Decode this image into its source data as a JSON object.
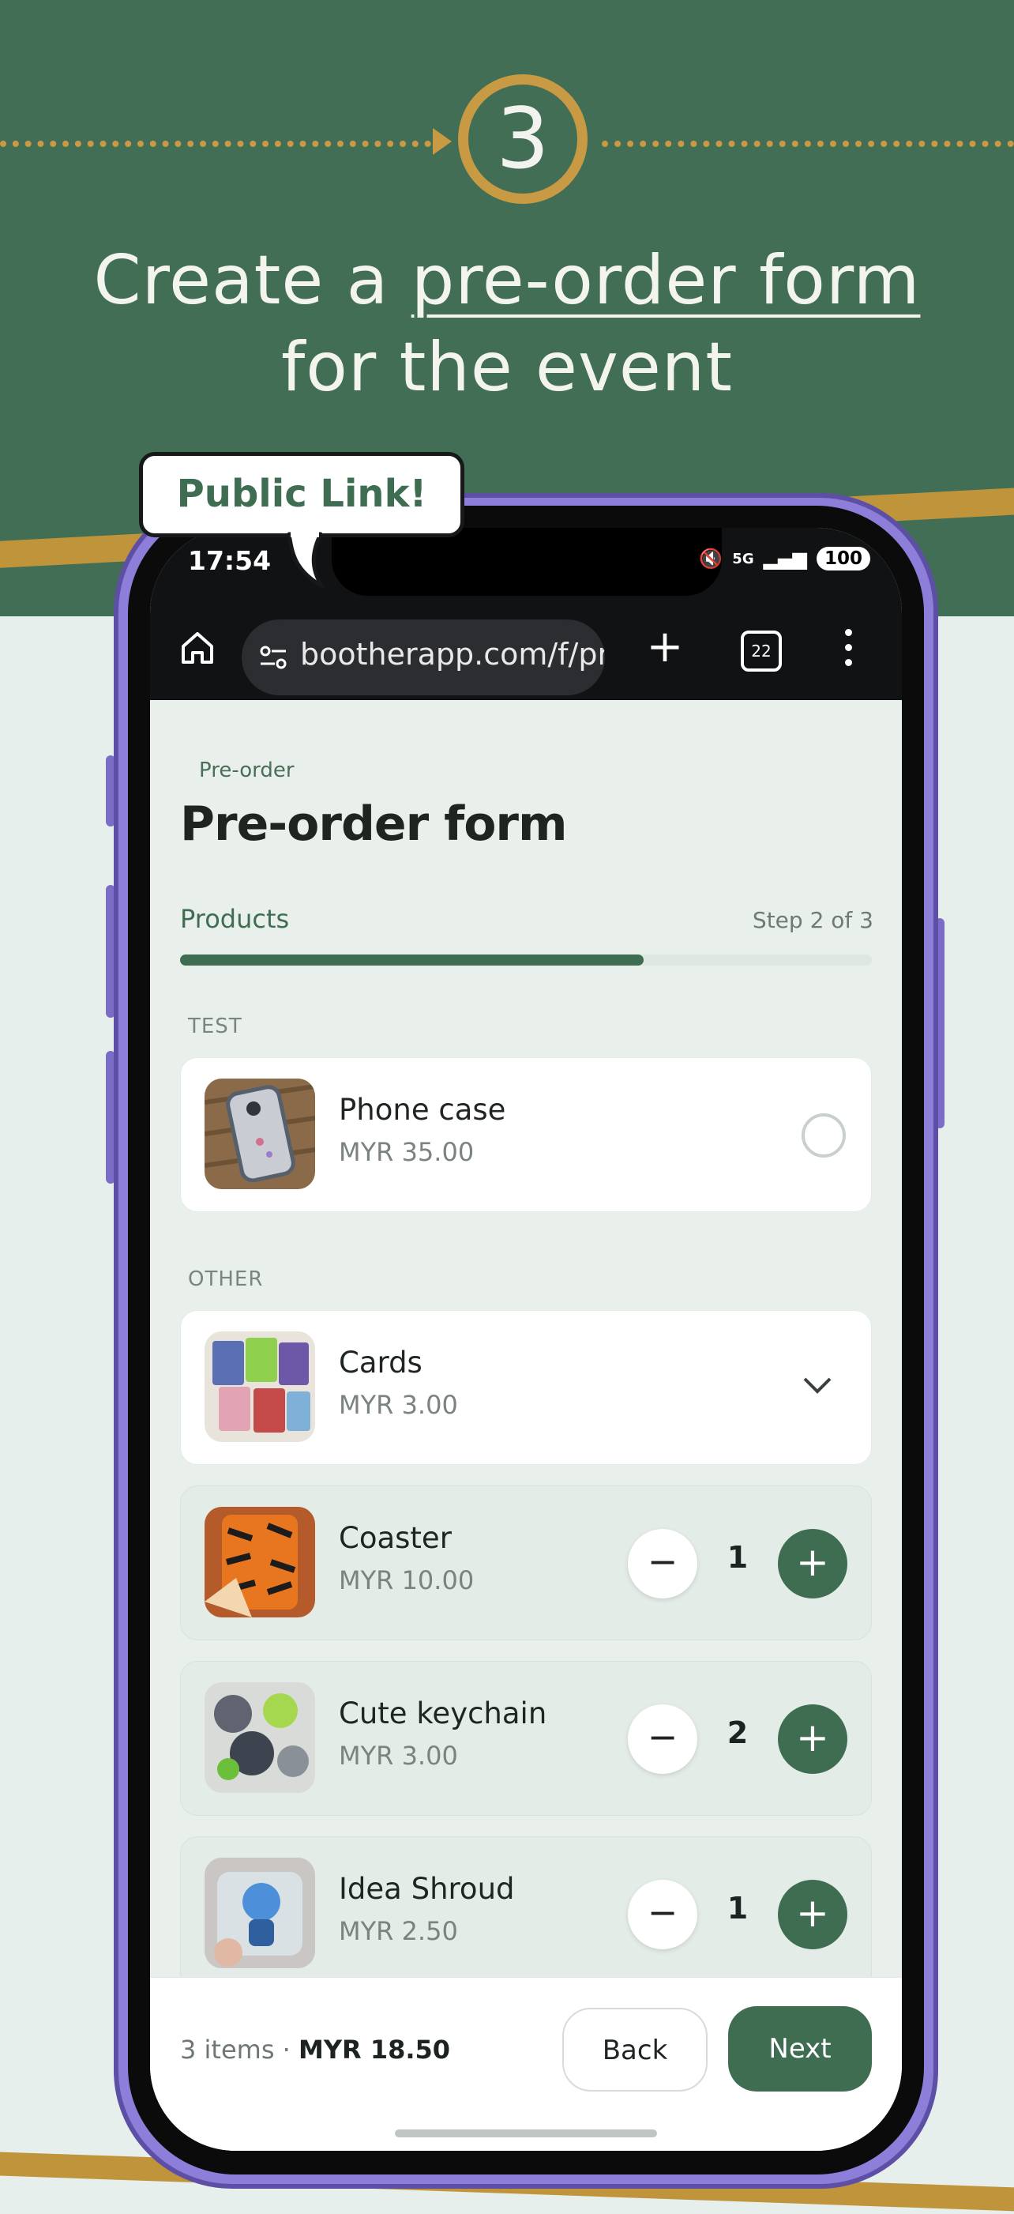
{
  "step_badge": {
    "number": "3"
  },
  "headline": {
    "before": "Create a ",
    "link": "pre-order form",
    "after": " for the event"
  },
  "callout": {
    "text": "Public Link!"
  },
  "status_bar": {
    "time": "17:54",
    "network": "5G",
    "battery": "100"
  },
  "browser": {
    "url": "bootherapp.com/f/pr",
    "tab_count": "22"
  },
  "page": {
    "breadcrumb": "Pre-order",
    "title": "Pre-order form",
    "step_label": "Products",
    "step_count": "Step 2 of 3",
    "progress_fraction": 0.67
  },
  "sections": [
    {
      "label": "TEST"
    },
    {
      "label": "OTHER"
    }
  ],
  "products": [
    {
      "name": "Phone case",
      "price": "MYR 35.00",
      "control": "radio"
    },
    {
      "name": "Cards",
      "price": "MYR 3.00",
      "control": "expand"
    },
    {
      "name": "Coaster",
      "price": "MYR 10.00",
      "control": "stepper",
      "qty": "1"
    },
    {
      "name": "Cute keychain",
      "price": "MYR 3.00",
      "control": "stepper",
      "qty": "2"
    },
    {
      "name": "Idea Shroud",
      "price": "MYR 2.50",
      "control": "stepper",
      "qty": "1"
    }
  ],
  "footer": {
    "items": "3 items · ",
    "total": "MYR 18.50",
    "back_label": "Back",
    "next_label": "Next"
  },
  "colors": {
    "brand_green": "#3f6d52",
    "gold": "#c89a44",
    "phone_frame": "#8c7ed9"
  }
}
